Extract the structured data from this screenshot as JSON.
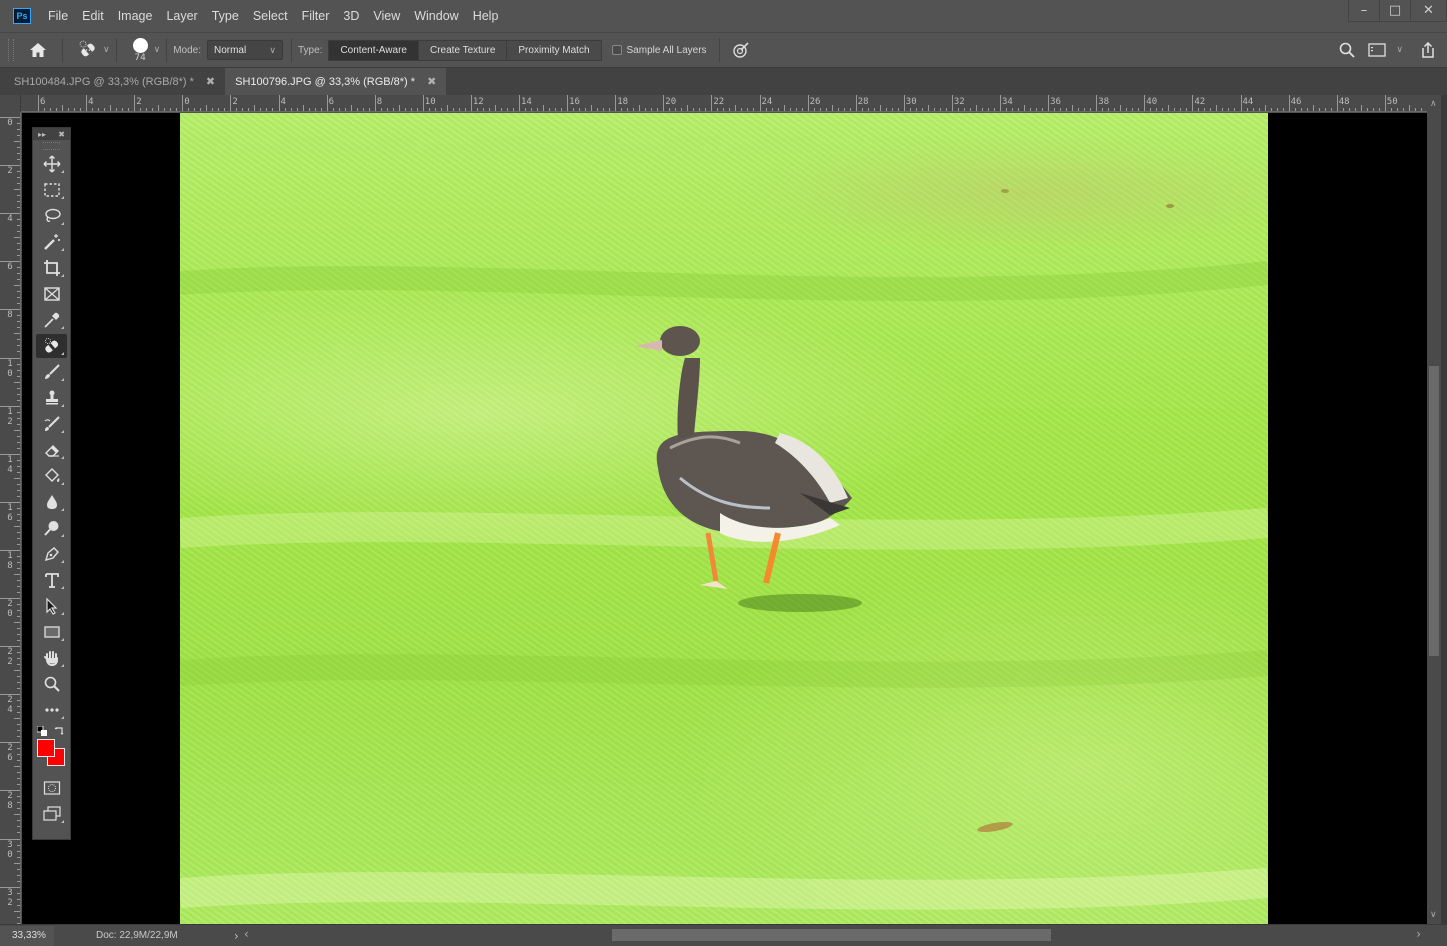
{
  "app": {
    "name": "Photoshop",
    "logo_text": "Ps"
  },
  "menu": [
    "File",
    "Edit",
    "Image",
    "Layer",
    "Type",
    "Select",
    "Filter",
    "3D",
    "View",
    "Window",
    "Help"
  ],
  "window_controls": {
    "minimize": "–",
    "maximize": "□",
    "close": "✕"
  },
  "options_bar": {
    "home_icon": "home-icon",
    "tool_icon": "spot-healing-brush-icon",
    "brush_size": "74",
    "mode_label": "Mode:",
    "mode_value": "Normal",
    "type_label": "Type:",
    "type_options": [
      {
        "label": "Content-Aware",
        "selected": true
      },
      {
        "label": "Create Texture",
        "selected": false
      },
      {
        "label": "Proximity Match",
        "selected": false
      }
    ],
    "sample_all_layers_label": "Sample All Layers",
    "sample_all_layers_checked": false,
    "pressure_icon": "pressure-size-icon",
    "right_icons": [
      "search-icon",
      "workspace-icon",
      "share-icon"
    ]
  },
  "tabs": [
    {
      "label": "SH100484.JPG @ 33,3% (RGB/8*) *",
      "active": false
    },
    {
      "label": "SH100796.JPG @ 33,3% (RGB/8*) *",
      "active": true
    }
  ],
  "ruler": {
    "horizontal_labels": [
      "6",
      "4",
      "2",
      "0",
      "2",
      "4",
      "6",
      "8",
      "10",
      "12",
      "14",
      "16",
      "18",
      "20",
      "22",
      "24",
      "26",
      "28",
      "30",
      "32",
      "34",
      "36",
      "38",
      "40",
      "42",
      "44",
      "46",
      "48",
      "50"
    ],
    "vertical_labels": [
      "0",
      "2",
      "4",
      "6",
      "8",
      "10",
      "12",
      "14",
      "16",
      "18",
      "20",
      "22",
      "24",
      "26",
      "28",
      "30",
      "32"
    ]
  },
  "toolbox": {
    "tools": [
      {
        "name": "move-tool",
        "active": false
      },
      {
        "name": "rectangular-marquee-tool",
        "active": false
      },
      {
        "name": "lasso-tool",
        "active": false
      },
      {
        "name": "magic-wand-tool",
        "active": false
      },
      {
        "name": "crop-tool",
        "active": false
      },
      {
        "name": "frame-tool",
        "active": false
      },
      {
        "name": "eyedropper-tool",
        "active": false
      },
      {
        "name": "spot-healing-brush-tool",
        "active": true
      },
      {
        "name": "brush-tool",
        "active": false
      },
      {
        "name": "clone-stamp-tool",
        "active": false
      },
      {
        "name": "history-brush-tool",
        "active": false
      },
      {
        "name": "eraser-tool",
        "active": false
      },
      {
        "name": "paint-bucket-tool",
        "active": false
      },
      {
        "name": "blur-tool",
        "active": false
      },
      {
        "name": "dodge-tool",
        "active": false
      },
      {
        "name": "pen-tool",
        "active": false
      },
      {
        "name": "type-tool",
        "active": false
      },
      {
        "name": "path-selection-tool",
        "active": false
      },
      {
        "name": "rectangle-tool",
        "active": false
      },
      {
        "name": "hand-tool",
        "active": false
      },
      {
        "name": "zoom-tool",
        "active": false
      },
      {
        "name": "edit-toolbar",
        "active": false
      }
    ],
    "foreground_color": "#ff0000",
    "background_color": "#ff0000"
  },
  "status": {
    "zoom": "33,33%",
    "doc": "Doc: 22,9M/22,9M",
    "arrow": "›"
  },
  "scroll": {
    "left_arrow": "‹",
    "right_arrow": "›"
  }
}
